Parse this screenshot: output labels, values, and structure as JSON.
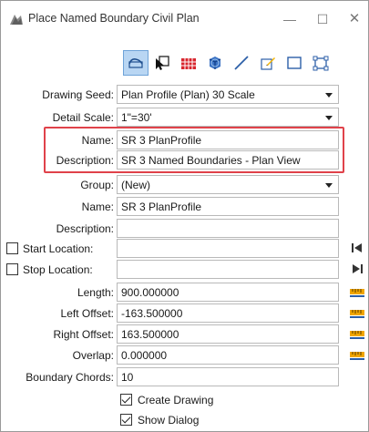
{
  "window": {
    "title": "Place Named Boundary Civil Plan",
    "controls": {
      "minimize": "—",
      "maximize": "☐",
      "close": "✕"
    }
  },
  "toolbar": {
    "tools": [
      {
        "icon": "civil-plan-tool-icon",
        "selected": true
      },
      {
        "icon": "select-element-icon",
        "selected": false
      },
      {
        "icon": "grid-table-icon",
        "selected": false
      },
      {
        "icon": "3d-box-icon",
        "selected": false
      },
      {
        "icon": "line-tool-icon",
        "selected": false
      },
      {
        "icon": "edit-shape-icon",
        "selected": false
      },
      {
        "icon": "rectangle-icon",
        "selected": false
      },
      {
        "icon": "shape-points-icon",
        "selected": false
      }
    ]
  },
  "form": {
    "drawing_seed": {
      "label": "Drawing Seed:",
      "value": "Plan Profile (Plan) 30 Scale"
    },
    "detail_scale": {
      "label": "Detail Scale:",
      "value": "1\"=30'"
    },
    "name_top": {
      "label": "Name:",
      "value": "SR 3 PlanProfile"
    },
    "description_top": {
      "label": "Description:",
      "value": "SR 3 Named Boundaries - Plan View"
    },
    "group": {
      "label": "Group:",
      "value": "(New)"
    },
    "name": {
      "label": "Name:",
      "value": "SR 3 PlanProfile"
    },
    "description": {
      "label": "Description:",
      "value": ""
    },
    "start_location": {
      "label": "Start Location:",
      "value": "",
      "checked": false
    },
    "stop_location": {
      "label": "Stop Location:",
      "value": "",
      "checked": false
    },
    "length": {
      "label": "Length:",
      "value": "900.000000"
    },
    "left_offset": {
      "label": "Left Offset:",
      "value": "-163.500000"
    },
    "right_offset": {
      "label": "Right Offset:",
      "value": "163.500000"
    },
    "overlap": {
      "label": "Overlap:",
      "value": "0.000000"
    },
    "boundary_chords": {
      "label": "Boundary Chords:",
      "value": "10"
    },
    "create_drawing": {
      "label": "Create Drawing",
      "checked": true
    },
    "show_dialog": {
      "label": "Show Dialog",
      "checked": true
    }
  },
  "colors": {
    "highlight": "#e0424a",
    "selected_tool": "#b9d6f3"
  }
}
